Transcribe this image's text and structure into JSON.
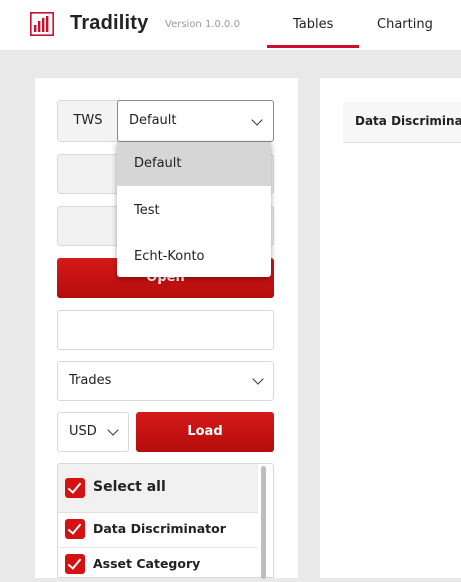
{
  "header": {
    "brand": "Tradility",
    "version": "Version 1.0.0.0",
    "tabs": [
      {
        "label": "Tables",
        "active": true
      },
      {
        "label": "Charting",
        "active": false
      }
    ],
    "accent_color": "#c8102e"
  },
  "sidebar": {
    "tws_label": "TWS",
    "profile_select": {
      "value": "Default",
      "options": [
        "Default",
        "Test",
        "Echt-Konto"
      ]
    },
    "open_button": "Open",
    "report_select": "Trades",
    "currency_select": "USD",
    "load_button": "Load",
    "fields": {
      "select_all": "Select all",
      "items": [
        "Data Discriminator",
        "Asset Category"
      ]
    }
  },
  "table": {
    "first_column": "Data Discriminator"
  }
}
